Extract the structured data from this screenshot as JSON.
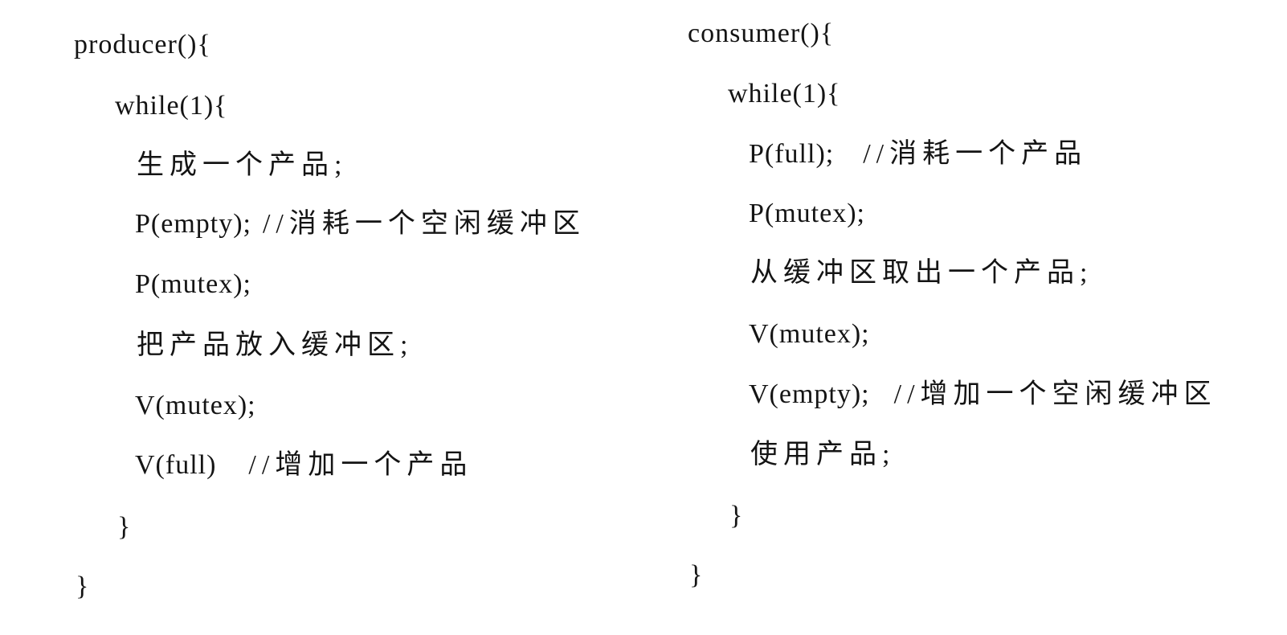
{
  "producer": {
    "header": "producer(){",
    "while": "while(1){",
    "line1": "生成一个产品;",
    "line2_code": "P(empty);",
    "line2_comment": "//消耗一个空闲缓冲区",
    "line3": "P(mutex);",
    "line4": "把产品放入缓冲区;",
    "line5": "V(mutex);",
    "line6_code": "V(full)",
    "line6_comment": "//增加一个产品",
    "close_inner": "}",
    "close_outer": "}"
  },
  "consumer": {
    "header": "consumer(){",
    "while": "while(1){",
    "line1_code": "P(full);",
    "line1_comment": "//消耗一个产品",
    "line2": "P(mutex);",
    "line3": "从缓冲区取出一个产品;",
    "line4": "V(mutex);",
    "line5_code": "V(empty);",
    "line5_comment": "//增加一个空闲缓冲区",
    "line6": "使用产品;",
    "close_inner": "}",
    "close_outer": "}"
  }
}
